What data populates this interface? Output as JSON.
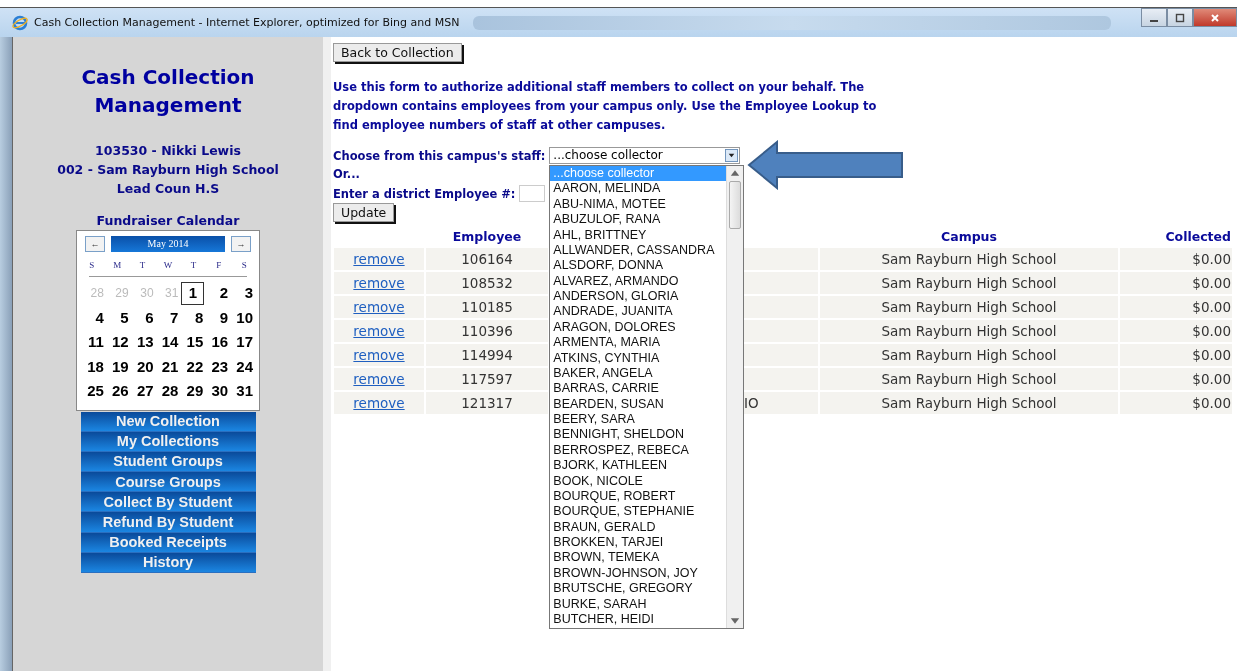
{
  "window": {
    "title": "Cash Collection Management - Internet Explorer, optimized for Bing and MSN"
  },
  "sidebar": {
    "app_title": "Cash Collection Management",
    "user_lines": [
      "103530 - Nikki Lewis",
      "002 - Sam Rayburn High School",
      "Lead Coun H.S"
    ],
    "calendar": {
      "title": "Fundraiser Calendar",
      "month": "May 2014",
      "prev": "←",
      "next": "→",
      "weekdays": [
        "S",
        "M",
        "T",
        "W",
        "T",
        "F",
        "S"
      ],
      "days": [
        {
          "label": "28",
          "muted": true,
          "today": false
        },
        {
          "label": "29",
          "muted": true,
          "today": false
        },
        {
          "label": "30",
          "muted": true,
          "today": false
        },
        {
          "label": "31",
          "muted": true,
          "today": false
        },
        {
          "label": "1",
          "muted": false,
          "today": true
        },
        {
          "label": "2",
          "muted": false,
          "today": false
        },
        {
          "label": "3",
          "muted": false,
          "today": false
        },
        {
          "label": "4",
          "muted": false,
          "today": false
        },
        {
          "label": "5",
          "muted": false,
          "today": false
        },
        {
          "label": "6",
          "muted": false,
          "today": false
        },
        {
          "label": "7",
          "muted": false,
          "today": false
        },
        {
          "label": "8",
          "muted": false,
          "today": false
        },
        {
          "label": "9",
          "muted": false,
          "today": false
        },
        {
          "label": "10",
          "muted": false,
          "today": false
        },
        {
          "label": "11",
          "muted": false,
          "today": false
        },
        {
          "label": "12",
          "muted": false,
          "today": false
        },
        {
          "label": "13",
          "muted": false,
          "today": false
        },
        {
          "label": "14",
          "muted": false,
          "today": false
        },
        {
          "label": "15",
          "muted": false,
          "today": false
        },
        {
          "label": "16",
          "muted": false,
          "today": false
        },
        {
          "label": "17",
          "muted": false,
          "today": false
        },
        {
          "label": "18",
          "muted": false,
          "today": false
        },
        {
          "label": "19",
          "muted": false,
          "today": false
        },
        {
          "label": "20",
          "muted": false,
          "today": false
        },
        {
          "label": "21",
          "muted": false,
          "today": false
        },
        {
          "label": "22",
          "muted": false,
          "today": false
        },
        {
          "label": "23",
          "muted": false,
          "today": false
        },
        {
          "label": "24",
          "muted": false,
          "today": false
        },
        {
          "label": "25",
          "muted": false,
          "today": false
        },
        {
          "label": "26",
          "muted": false,
          "today": false
        },
        {
          "label": "27",
          "muted": false,
          "today": false
        },
        {
          "label": "28",
          "muted": false,
          "today": false
        },
        {
          "label": "29",
          "muted": false,
          "today": false
        },
        {
          "label": "30",
          "muted": false,
          "today": false
        },
        {
          "label": "31",
          "muted": false,
          "today": false
        }
      ]
    },
    "nav": [
      "New Collection",
      "My Collections",
      "Student Groups",
      "Course Groups",
      "Collect By Student",
      "Refund By Student",
      "Booked Receipts",
      "History"
    ]
  },
  "main": {
    "back_button": "Back to Collection",
    "intro": "Use this form to authorize additional staff members to collect on your behalf. The dropdown contains employees from your campus only. Use the Employee Lookup to find employee numbers of staff at other campuses.",
    "choose_label": "Choose from this campus's staff:",
    "select_value": "...choose collector",
    "or_label": "Or...",
    "employee_label": "Enter a district Employee #:",
    "update_button": "Update",
    "dropdown_options": [
      {
        "label": "...choose collector",
        "selected": true
      },
      {
        "label": "AARON, MELINDA",
        "selected": false
      },
      {
        "label": "ABU-NIMA, MOTEE",
        "selected": false
      },
      {
        "label": "ABUZULOF, RANA",
        "selected": false
      },
      {
        "label": "AHL, BRITTNEY",
        "selected": false
      },
      {
        "label": "ALLWANDER, CASSANDRA",
        "selected": false
      },
      {
        "label": "ALSDORF, DONNA",
        "selected": false
      },
      {
        "label": "ALVAREZ, ARMANDO",
        "selected": false
      },
      {
        "label": "ANDERSON, GLORIA",
        "selected": false
      },
      {
        "label": "ANDRADE, JUANITA",
        "selected": false
      },
      {
        "label": "ARAGON, DOLORES",
        "selected": false
      },
      {
        "label": "ARMENTA, MARIA",
        "selected": false
      },
      {
        "label": "ATKINS, CYNTHIA",
        "selected": false
      },
      {
        "label": "BAKER, ANGELA",
        "selected": false
      },
      {
        "label": "BARRAS, CARRIE",
        "selected": false
      },
      {
        "label": "BEARDEN, SUSAN",
        "selected": false
      },
      {
        "label": "BEERY, SARA",
        "selected": false
      },
      {
        "label": "BENNIGHT, SHELDON",
        "selected": false
      },
      {
        "label": "BERROSPEZ, REBECA",
        "selected": false
      },
      {
        "label": "BJORK, KATHLEEN",
        "selected": false
      },
      {
        "label": "BOOK, NICOLE",
        "selected": false
      },
      {
        "label": "BOURQUE, ROBERT",
        "selected": false
      },
      {
        "label": "BOURQUE, STEPHANIE",
        "selected": false
      },
      {
        "label": "BRAUN, GERALD",
        "selected": false
      },
      {
        "label": "BROKKEN, TARJEI",
        "selected": false
      },
      {
        "label": "BROWN, TEMEKA",
        "selected": false
      },
      {
        "label": "BROWN-JOHNSON, JOY",
        "selected": false
      },
      {
        "label": "BRUTSCHE, GREGORY",
        "selected": false
      },
      {
        "label": "BURKE, SARAH",
        "selected": false
      },
      {
        "label": "BUTCHER, HEIDI",
        "selected": false
      }
    ],
    "table": {
      "columns": [
        "",
        "Employee",
        "",
        "Campus",
        "Collected"
      ],
      "rows": [
        {
          "action": "remove",
          "employee": "106164",
          "column_3": "",
          "campus": "Sam Rayburn High School",
          "collected": "$0.00"
        },
        {
          "action": "remove",
          "employee": "108532",
          "column_3": "",
          "campus": "Sam Rayburn High School",
          "collected": "$0.00"
        },
        {
          "action": "remove",
          "employee": "110185",
          "column_3": "",
          "campus": "Sam Rayburn High School",
          "collected": "$0.00"
        },
        {
          "action": "remove",
          "employee": "110396",
          "column_3": "",
          "campus": "Sam Rayburn High School",
          "collected": "$0.00"
        },
        {
          "action": "remove",
          "employee": "114994",
          "column_3": "",
          "campus": "Sam Rayburn High School",
          "collected": "$0.00"
        },
        {
          "action": "remove",
          "employee": "117597",
          "column_3": "",
          "campus": "Sam Rayburn High School",
          "collected": "$0.00"
        },
        {
          "action": "remove",
          "employee": "121317",
          "column_3": "IO",
          "campus": "Sam Rayburn High School",
          "collected": "$0.00"
        }
      ]
    }
  }
}
